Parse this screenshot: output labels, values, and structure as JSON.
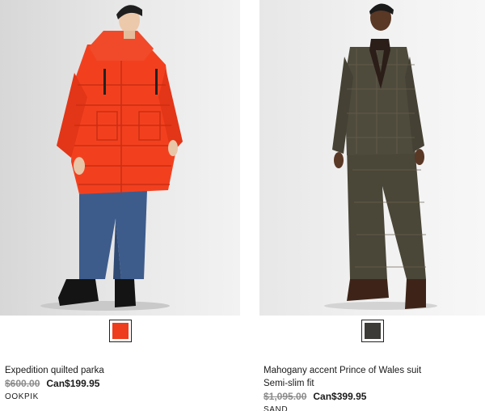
{
  "products": [
    {
      "title": "Expedition quilted parka",
      "subtitle": "",
      "old_price": "$600.00",
      "new_price": "Can$199.95",
      "brand": "OOKPIK",
      "swatch_color": "#ee3d1c",
      "image_alt": "Model wearing orange quilted parka"
    },
    {
      "title": "Mahogany accent Prince of Wales suit",
      "subtitle": "Semi-slim fit",
      "old_price": "$1,095.00",
      "new_price": "Can$399.95",
      "brand": "SAND",
      "swatch_color": "#3d3b37",
      "image_alt": "Model wearing brown Prince of Wales check suit"
    }
  ]
}
